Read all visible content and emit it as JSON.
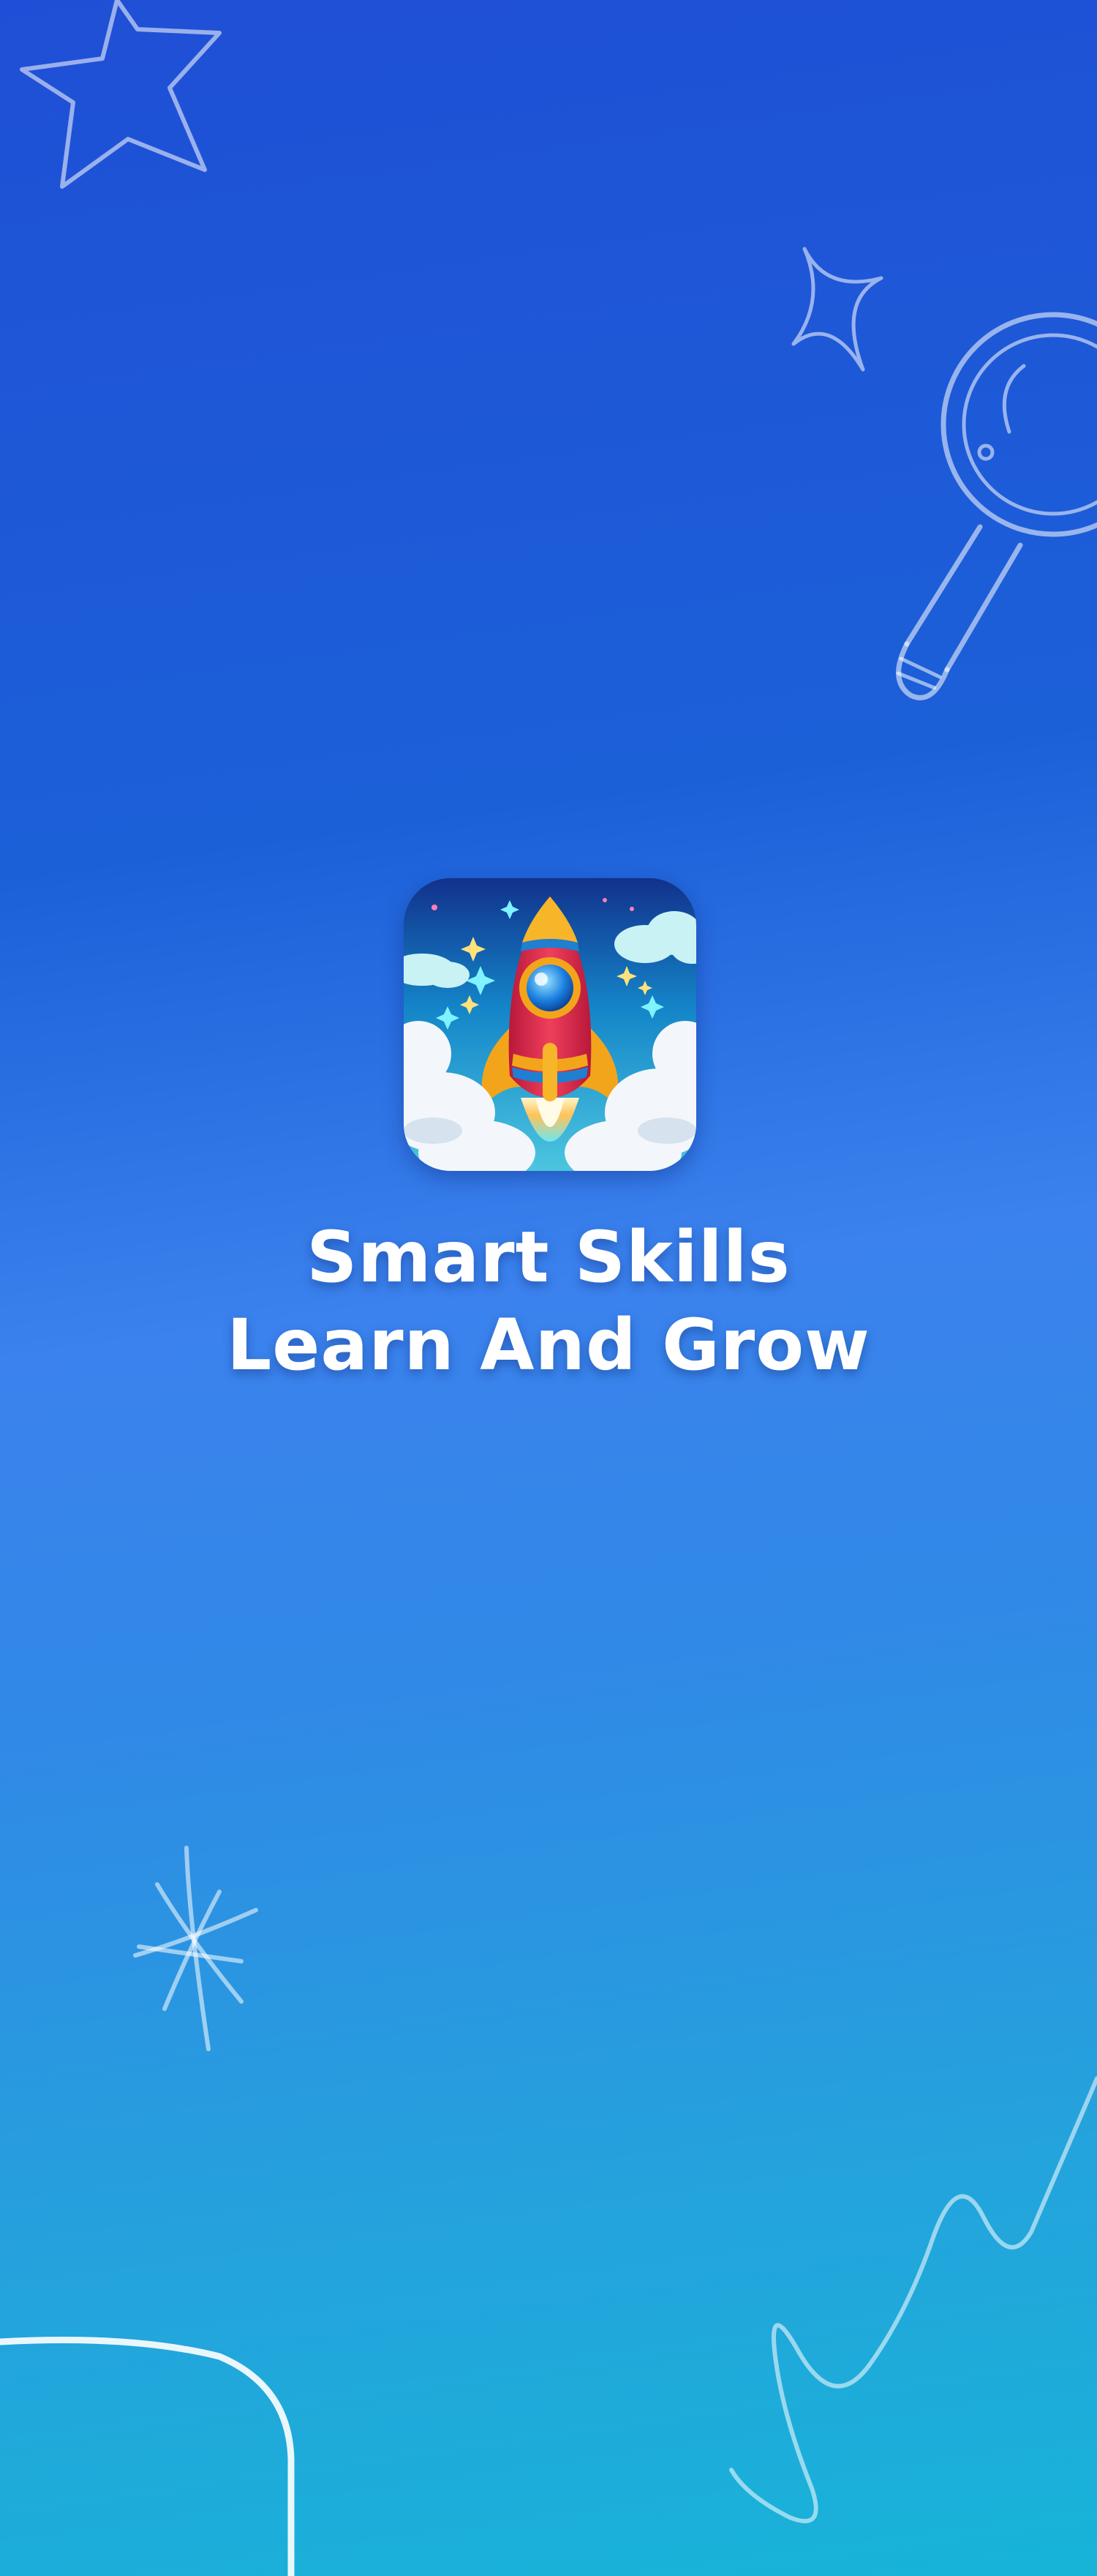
{
  "app": {
    "title_line1": "Smart Skills",
    "title_line2": "Learn And Grow"
  },
  "icons": {
    "app_icon": "rocket-icon",
    "decorations": [
      "star-outline-icon",
      "sparkle-icon",
      "magnifying-glass-icon",
      "asterisk-sparkle-icon",
      "wave-squiggle-icon",
      "curve-line-icon"
    ]
  },
  "colors": {
    "background_top": "#1f4fd6",
    "background_middle": "#3b82ee",
    "background_bottom": "#17b4d8",
    "text": "#ffffff",
    "rocket_body": "#e2304a",
    "rocket_fins": "#f2a51a",
    "rocket_window": "#1a7fe0"
  }
}
